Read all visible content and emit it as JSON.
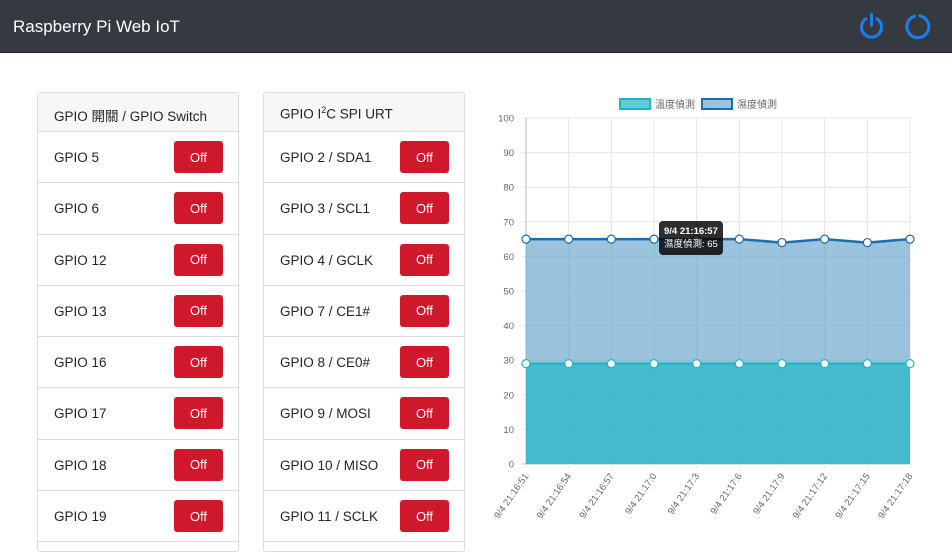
{
  "navbar": {
    "brand": "Raspberry Pi Web IoT",
    "power_icon": "power-icon",
    "refresh_icon": "refresh-icon",
    "icon_color": "#1e7cf2"
  },
  "gpio_card": {
    "title": "GPIO 開關 / GPIO Switch",
    "rows": [
      {
        "label": "GPIO 5",
        "button": "Off"
      },
      {
        "label": "GPIO 6",
        "button": "Off"
      },
      {
        "label": "GPIO 12",
        "button": "Off"
      },
      {
        "label": "GPIO 13",
        "button": "Off"
      },
      {
        "label": "GPIO 16",
        "button": "Off"
      },
      {
        "label": "GPIO 17",
        "button": "Off"
      },
      {
        "label": "GPIO 18",
        "button": "Off"
      },
      {
        "label": "GPIO 19",
        "button": "Off"
      }
    ]
  },
  "bus_card": {
    "title_pre": "GPIO I",
    "title_sup": "2",
    "title_post": "C SPI URT",
    "rows": [
      {
        "label": "GPIO 2 / SDA1",
        "button": "Off"
      },
      {
        "label": "GPIO 3 / SCL1",
        "button": "Off"
      },
      {
        "label": "GPIO 4 / GCLK",
        "button": "Off"
      },
      {
        "label": "GPIO 7 / CE1#",
        "button": "Off"
      },
      {
        "label": "GPIO 8 / CE0#",
        "button": "Off"
      },
      {
        "label": "GPIO 9 / MOSI",
        "button": "Off"
      },
      {
        "label": "GPIO 10 / MISO",
        "button": "Off"
      },
      {
        "label": "GPIO 11 / SCLK",
        "button": "Off"
      }
    ]
  },
  "colors": {
    "button_bg": "#d0182b",
    "navbar_bg": "#343a40"
  },
  "chart_data": {
    "type": "area",
    "x": [
      "9/4 21:16:51",
      "9/4 21:16:54",
      "9/4 21:16:57",
      "9/4 21:17:0",
      "9/4 21:17:3",
      "9/4 21:17:6",
      "9/4 21:17:9",
      "9/4 21:17:12",
      "9/4 21:17:15",
      "9/4 21:17:18"
    ],
    "series": [
      {
        "name": "溫度偵測",
        "values": [
          29,
          29,
          29,
          29,
          29,
          29,
          29,
          29,
          29,
          29
        ],
        "line_color": "#1fb7c4",
        "fill_color": "rgba(31,183,196,0.7)"
      },
      {
        "name": "濕度偵測",
        "values": [
          65,
          65,
          65,
          65,
          65,
          65,
          64,
          65,
          64,
          65
        ],
        "line_color": "#1b6fae",
        "fill_color": "rgba(100,165,205,0.65)"
      }
    ],
    "ylim": [
      0,
      100
    ],
    "yticks": [
      0,
      10,
      20,
      30,
      40,
      50,
      60,
      70,
      80,
      90,
      100
    ],
    "grid": true,
    "legend": "top-center",
    "tooltip": {
      "title": "9/4  21:16:57",
      "body": "濕度偵測: 65",
      "index": 2
    }
  }
}
